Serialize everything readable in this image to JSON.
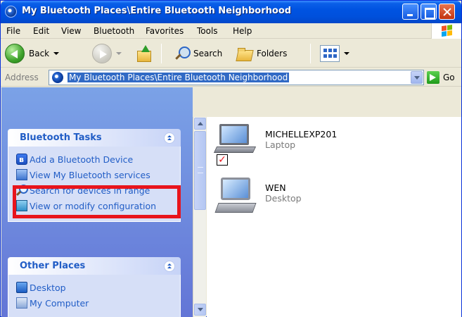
{
  "window": {
    "title": "My Bluetooth Places\\Entire Bluetooth Neighborhood"
  },
  "menubar": {
    "items": [
      "File",
      "Edit",
      "View",
      "Bluetooth",
      "Favorites",
      "Tools",
      "Help"
    ]
  },
  "toolbar": {
    "back_label": "Back",
    "search_label": "Search",
    "folders_label": "Folders"
  },
  "address": {
    "label": "Address",
    "value": "My Bluetooth Places\\Entire Bluetooth Neighborhood",
    "go_label": "Go"
  },
  "task_pane": {
    "bluetooth_tasks": {
      "title": "Bluetooth Tasks",
      "items": [
        {
          "label": "Add a Bluetooth Device",
          "icon": "bluetooth-icon"
        },
        {
          "label": "View My Bluetooth services",
          "icon": "services-icon"
        },
        {
          "label": "Search for devices in range",
          "icon": "search-icon"
        },
        {
          "label": "View or modify configuration",
          "icon": "configuration-icon"
        }
      ]
    },
    "other_places": {
      "title": "Other Places",
      "items": [
        {
          "label": "Desktop",
          "icon": "desktop-icon"
        },
        {
          "label": "My Computer",
          "icon": "my-computer-icon"
        }
      ]
    }
  },
  "devices": [
    {
      "name": "MICHELLEXP201",
      "type": "Laptop",
      "icon": "laptop-icon",
      "paired": true
    },
    {
      "name": "WEN",
      "type": "Desktop",
      "icon": "desktop-computer-icon",
      "paired": false
    }
  ],
  "colors": {
    "highlight": "#e8141c",
    "task_link": "#215dc6",
    "title_bar": "#0053e1"
  }
}
